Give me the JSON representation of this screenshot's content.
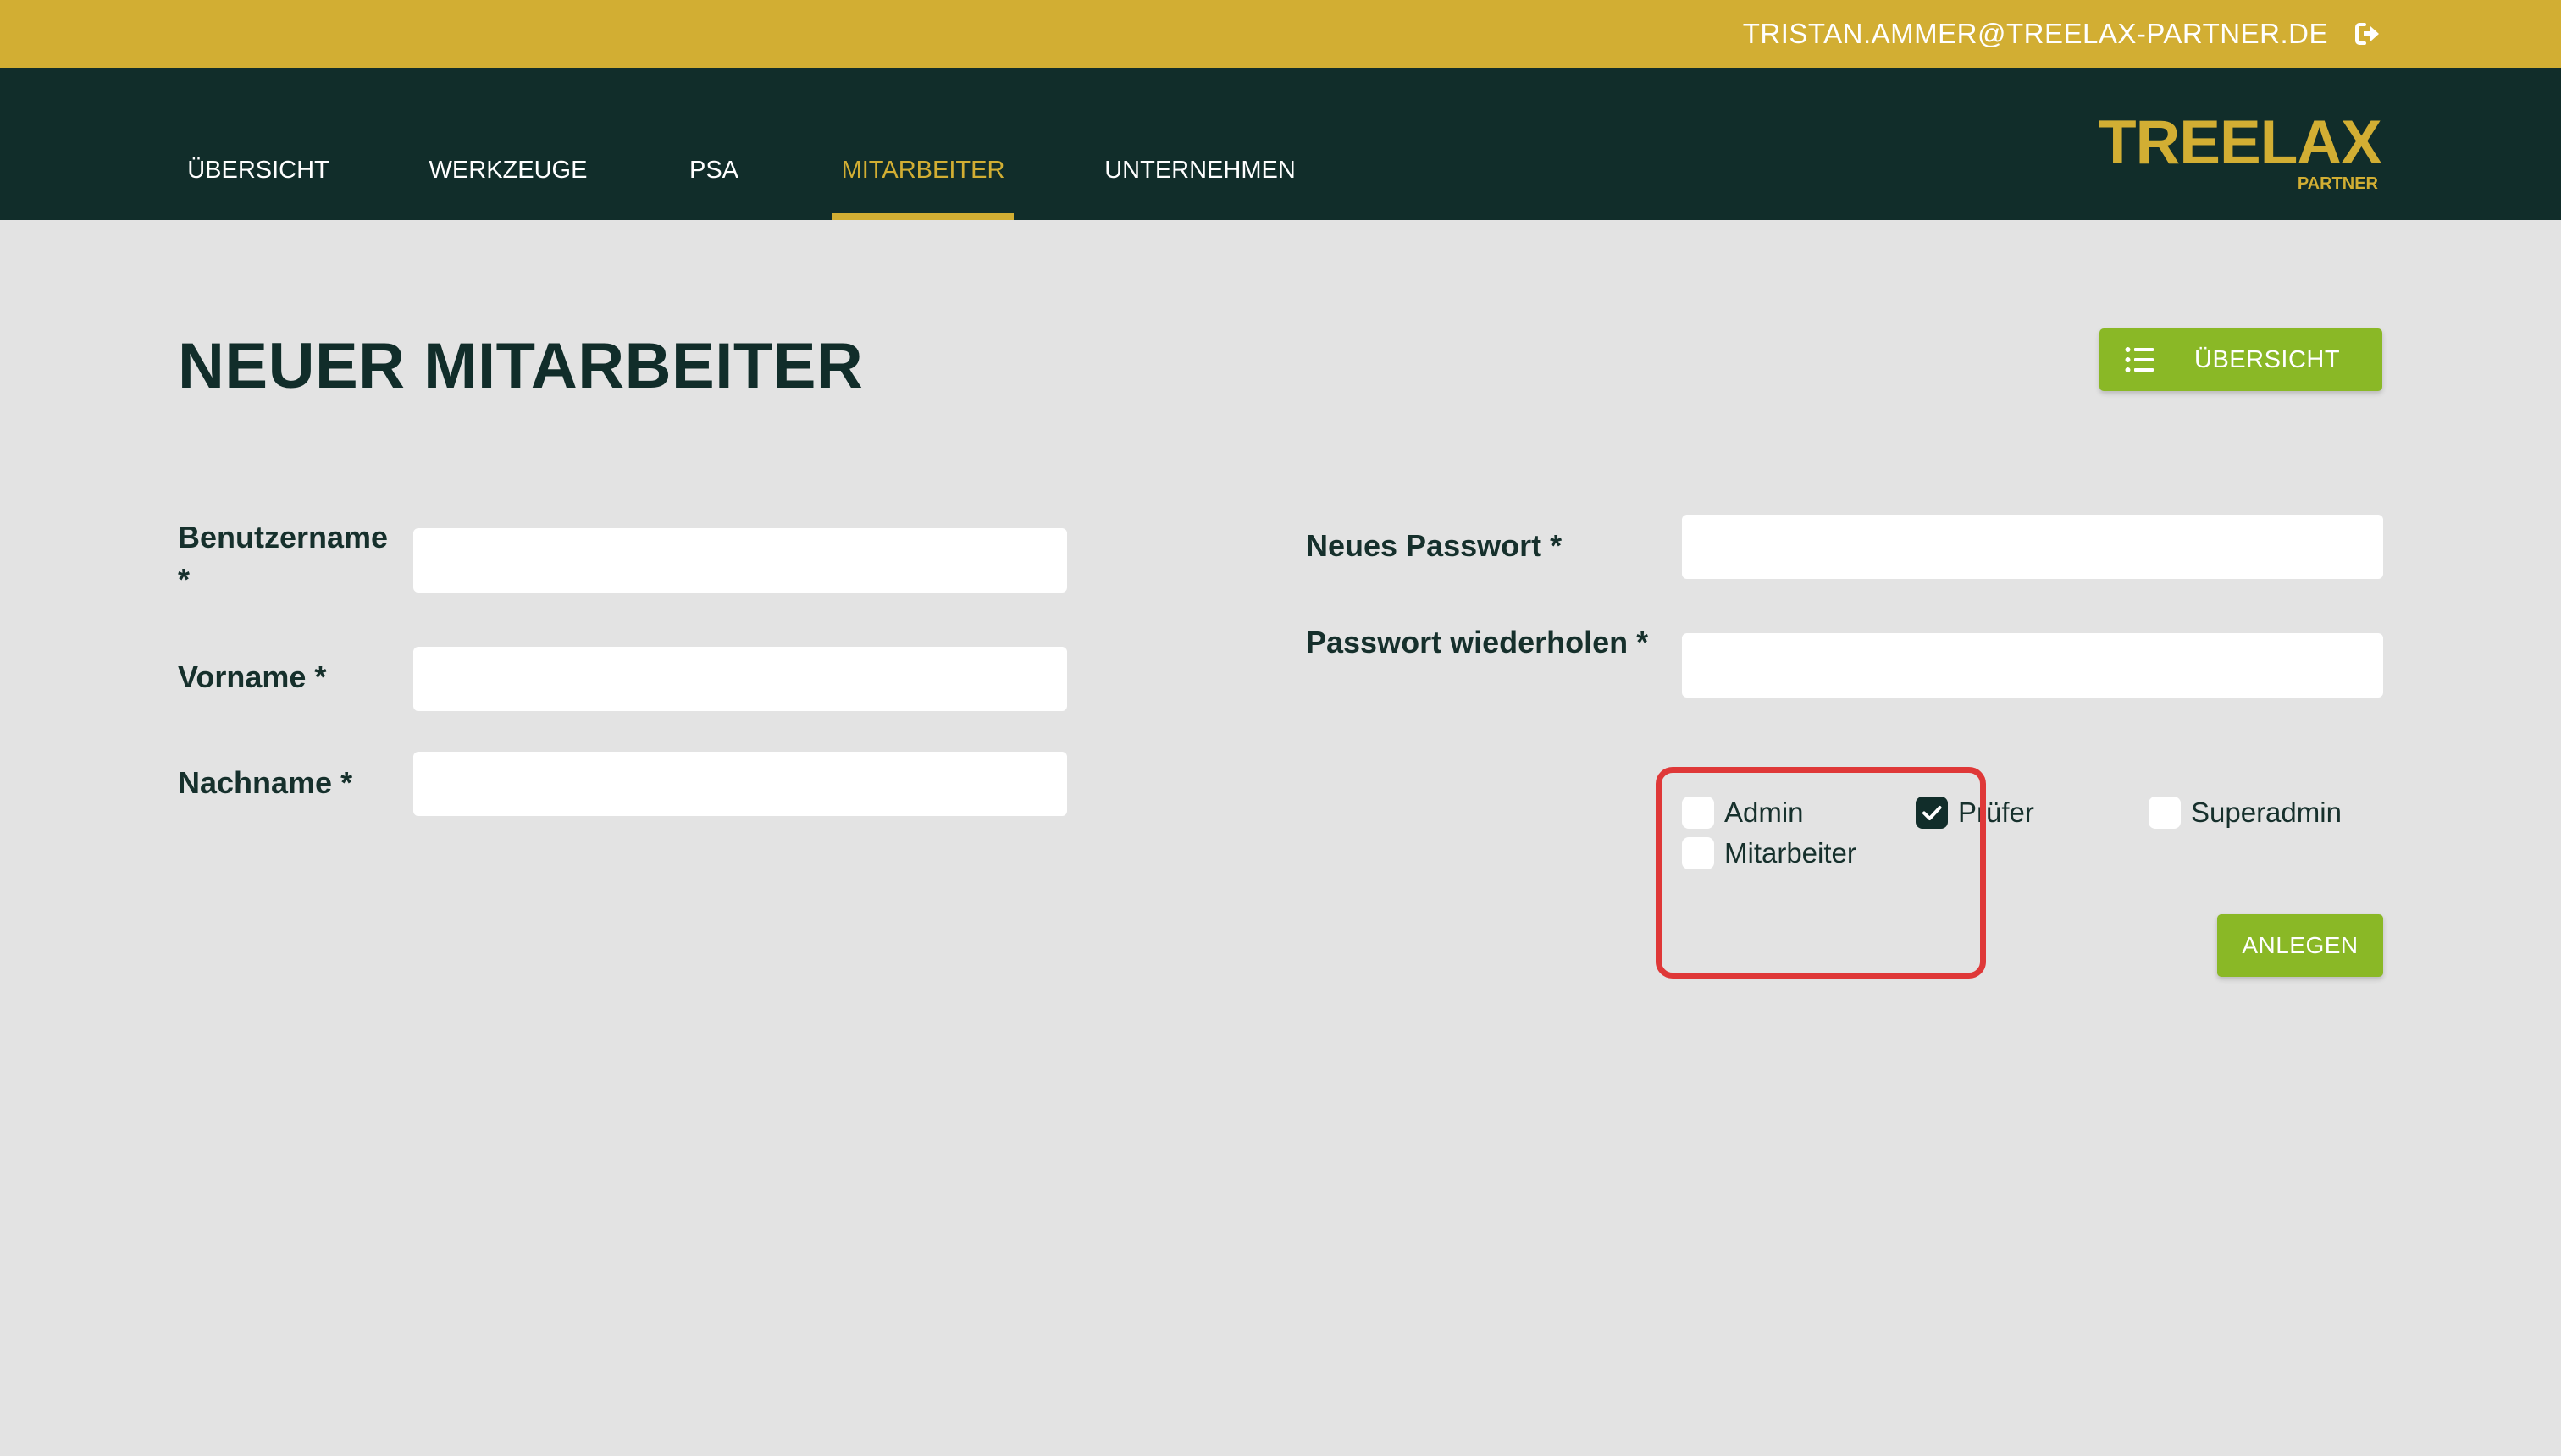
{
  "header": {
    "user_email": "TRISTAN.AMMER@TREELAX-PARTNER.DE",
    "logout_icon": "sign-out-icon"
  },
  "brand": {
    "name": "TREELAX",
    "subtitle": "PARTNER"
  },
  "nav": {
    "items": [
      {
        "label": "ÜBERSICHT",
        "active": false
      },
      {
        "label": "WERKZEUGE",
        "active": false
      },
      {
        "label": "PSA",
        "active": false
      },
      {
        "label": "MITARBEITER",
        "active": true
      },
      {
        "label": "UNTERNEHMEN",
        "active": false
      }
    ]
  },
  "page": {
    "title": "NEUER MITARBEITER",
    "overview_button": {
      "label": "ÜBERSICHT",
      "icon": "list-icon"
    }
  },
  "form": {
    "username": {
      "label": "Benutzername *",
      "value": ""
    },
    "first_name": {
      "label": "Vorname *",
      "value": ""
    },
    "last_name": {
      "label": "Nachname *",
      "value": ""
    },
    "new_password": {
      "label": "Neues Passwort *",
      "value": ""
    },
    "repeat_password": {
      "label": "Passwort wiederholen *",
      "value": ""
    },
    "roles": [
      {
        "label": "Admin",
        "checked": false
      },
      {
        "label": "Prüfer",
        "checked": true
      },
      {
        "label": "Superadmin",
        "checked": false
      },
      {
        "label": "Mitarbeiter",
        "checked": false
      }
    ],
    "submit_label": "ANLEGEN"
  },
  "colors": {
    "top_bar": "#d2ae33",
    "nav_bar": "#112d2a",
    "accent_green": "#8ab826",
    "background": "#e3e3e3",
    "highlight": "#df3838"
  }
}
